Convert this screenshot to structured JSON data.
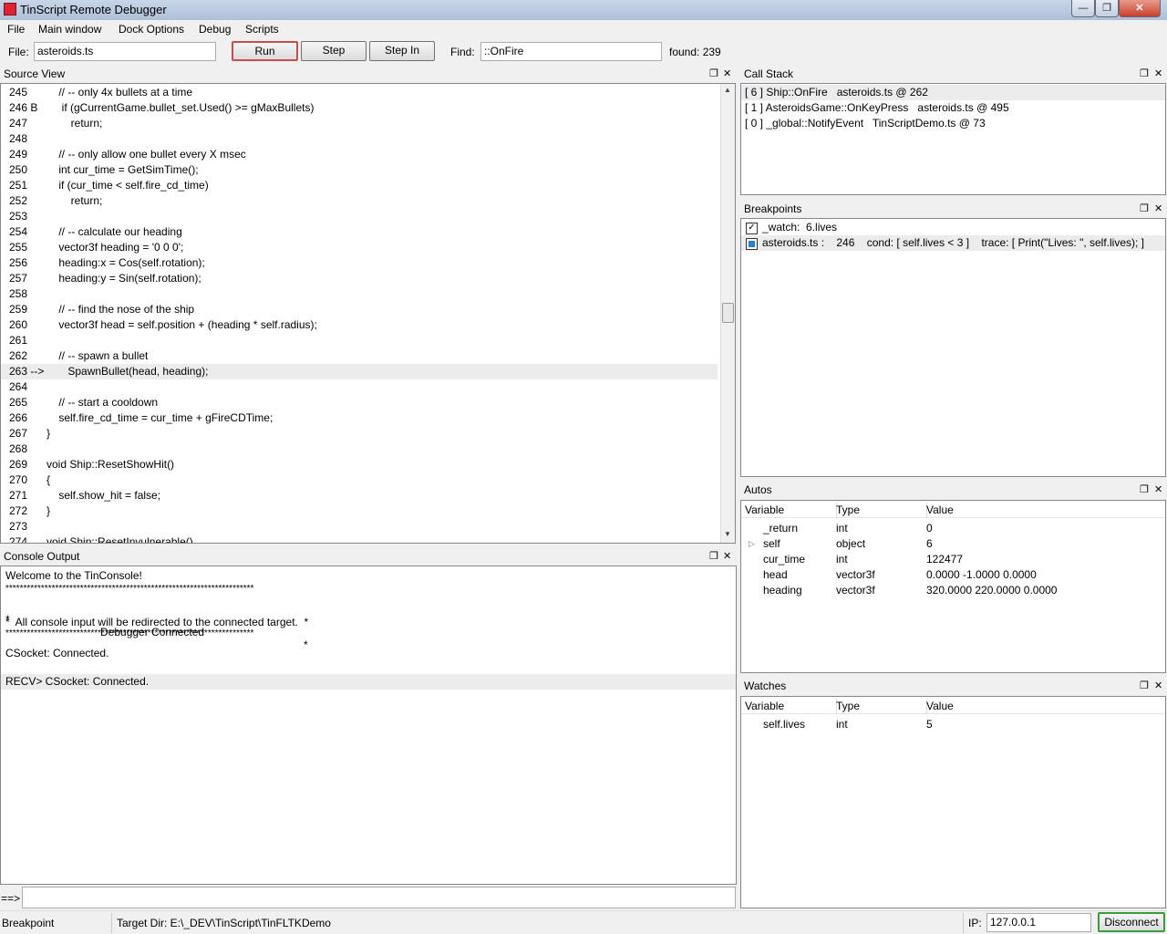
{
  "window": {
    "title": "TinScript Remote Debugger",
    "min_label": "—",
    "max_label": "❐",
    "close_label": "✕"
  },
  "menu": [
    "File",
    "Main window",
    "Dock Options",
    "Debug",
    "Scripts"
  ],
  "toolbar": {
    "file_label": "File:",
    "file_value": "asteroids.ts",
    "run_label": "Run",
    "step_label": "Step",
    "step_in_label": "Step In",
    "find_label": "Find:",
    "find_value": "::OnFire",
    "found_text": "found: 239"
  },
  "source_view": {
    "title": "Source View",
    "lines": [
      {
        "num": "245",
        "text": "    // -- only 4x bullets at a time"
      },
      {
        "num": "246 B",
        "text": "     if (gCurrentGame.bullet_set.Used() >= gMaxBullets)"
      },
      {
        "num": "247",
        "text": "        return;"
      },
      {
        "num": "248",
        "text": ""
      },
      {
        "num": "249",
        "text": "    // -- only allow one bullet every X msec"
      },
      {
        "num": "250",
        "text": "    int cur_time = GetSimTime();"
      },
      {
        "num": "251",
        "text": "    if (cur_time < self.fire_cd_time)"
      },
      {
        "num": "252",
        "text": "        return;"
      },
      {
        "num": "253",
        "text": ""
      },
      {
        "num": "254",
        "text": "    // -- calculate our heading"
      },
      {
        "num": "255",
        "text": "    vector3f heading = '0 0 0';"
      },
      {
        "num": "256",
        "text": "    heading:x = Cos(self.rotation);"
      },
      {
        "num": "257",
        "text": "    heading:y = Sin(self.rotation);"
      },
      {
        "num": "258",
        "text": ""
      },
      {
        "num": "259",
        "text": "    // -- find the nose of the ship"
      },
      {
        "num": "260",
        "text": "    vector3f head = self.position + (heading * self.radius);"
      },
      {
        "num": "261",
        "text": ""
      },
      {
        "num": "262",
        "text": "    // -- spawn a bullet"
      },
      {
        "num": "263 -->",
        "text": "       SpawnBullet(head, heading);"
      },
      {
        "num": "264",
        "text": ""
      },
      {
        "num": "265",
        "text": "    // -- start a cooldown"
      },
      {
        "num": "266",
        "text": "    self.fire_cd_time = cur_time + gFireCDTime;"
      },
      {
        "num": "267",
        "text": "}"
      },
      {
        "num": "268",
        "text": ""
      },
      {
        "num": "269",
        "text": "void Ship::ResetShowHit()"
      },
      {
        "num": "270",
        "text": "{"
      },
      {
        "num": "271",
        "text": "    self.show_hit = false;"
      },
      {
        "num": "272",
        "text": "}"
      },
      {
        "num": "273",
        "text": ""
      },
      {
        "num": "274",
        "text": "void Ship::ResetInvulnerable()"
      }
    ]
  },
  "console": {
    "title": "Console Output",
    "lines": [
      "Welcome to the TinConsole!",
      "**********************************************************************",
      "*                              Debugger Connected                              *",
      "*  All console input will be redirected to the connected target.  *",
      "**********************************************************************",
      "CSocket: Connected.",
      "",
      "RECV> CSocket: Connected."
    ],
    "prompt": "==>"
  },
  "call_stack": {
    "title": "Call Stack",
    "entries": [
      "[ 6 ] Ship::OnFire   asteroids.ts @ 262",
      "[ 1 ] AsteroidsGame::OnKeyPress   asteroids.ts @ 495",
      "[ 0 ] _global::NotifyEvent   TinScriptDemo.ts @ 73"
    ]
  },
  "breakpoints": {
    "title": "Breakpoints",
    "entries": [
      {
        "checked": true,
        "text": "_watch:  6.lives"
      },
      {
        "checked": false,
        "text": "asteroids.ts :    246    cond: [ self.lives < 3 ]    trace: [ Print(\"Lives: \", self.lives); ]"
      }
    ]
  },
  "autos": {
    "title": "Autos",
    "headers": [
      "Variable",
      "Type",
      "Value"
    ],
    "rows": [
      {
        "variable": "_return",
        "type": "int",
        "value": "0"
      },
      {
        "variable": "self",
        "type": "object",
        "value": "6"
      },
      {
        "variable": "cur_time",
        "type": "int",
        "value": "122477"
      },
      {
        "variable": "head",
        "type": "vector3f",
        "value": "0.0000 -1.0000 0.0000"
      },
      {
        "variable": "heading",
        "type": "vector3f",
        "value": "320.0000 220.0000 0.0000"
      }
    ]
  },
  "watches": {
    "title": "Watches",
    "headers": [
      "Variable",
      "Type",
      "Value"
    ],
    "rows": [
      {
        "variable": "self.lives",
        "type": "int",
        "value": "5"
      }
    ]
  },
  "statusbar": {
    "mode": "Breakpoint",
    "target_dir": "Target Dir: E:\\_DEV\\TinScript\\TinFLTKDemo",
    "ip_label": "IP:",
    "ip_value": "127.0.0.1",
    "disconnect_label": "Disconnect"
  },
  "icons": {
    "float": "❐",
    "close": "✕",
    "expand": "▷",
    "scroll_up": "▲",
    "scroll_down": "▼"
  }
}
